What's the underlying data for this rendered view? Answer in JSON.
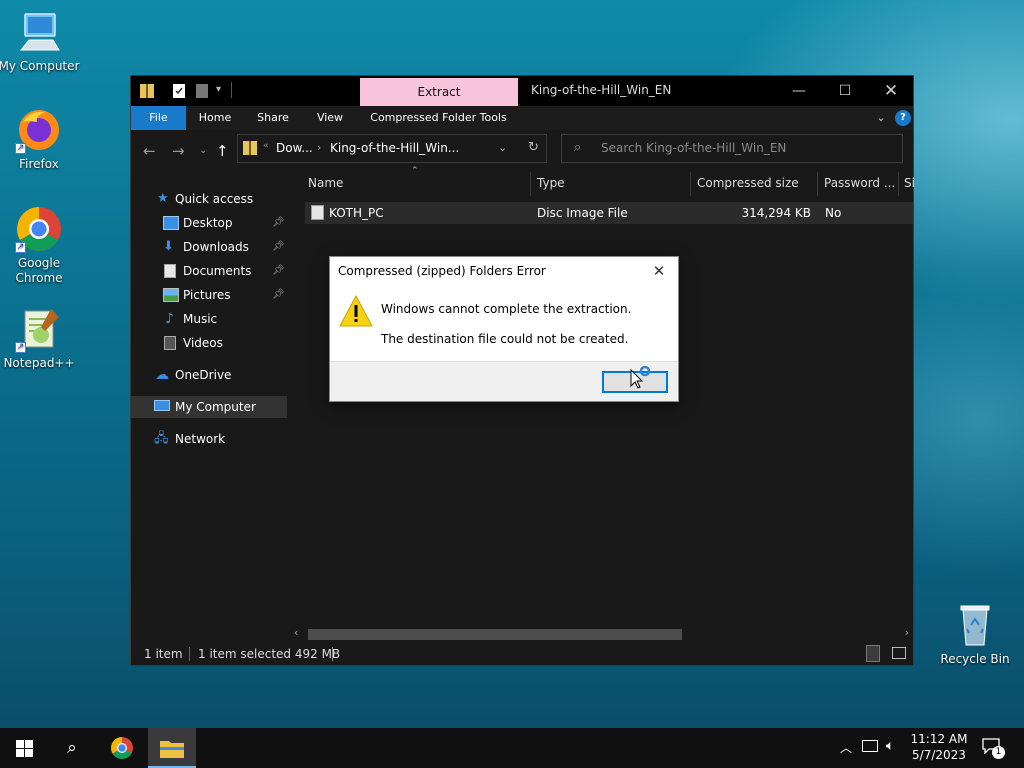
{
  "desktop": {
    "icons": [
      {
        "label": "My Computer",
        "icon": "computer-icon"
      },
      {
        "label": "Firefox",
        "icon": "firefox-icon"
      },
      {
        "label": "Google Chrome",
        "icon": "chrome-icon"
      },
      {
        "label": "Notepad++",
        "icon": "notepadpp-icon"
      },
      {
        "label": "Recycle Bin",
        "icon": "recycle-bin-icon"
      }
    ]
  },
  "explorer": {
    "title": "King-of-the-Hill_Win_EN",
    "context_tab": "Extract",
    "context_tab_color": "#f8c4dc",
    "ribbon_tabs": [
      "File",
      "Home",
      "Share",
      "View",
      "Compressed Folder Tools"
    ],
    "address": {
      "parent": "Dow...",
      "current": "King-of-the-Hill_Win..."
    },
    "search_placeholder": "Search King-of-the-Hill_Win_EN",
    "nav": {
      "quick_access": "Quick access",
      "items": [
        "Desktop",
        "Downloads",
        "Documents",
        "Pictures",
        "Music",
        "Videos"
      ],
      "onedrive": "OneDrive",
      "my_computer": "My Computer",
      "network": "Network"
    },
    "columns": [
      "Name",
      "Type",
      "Compressed size",
      "Password ...",
      "Si"
    ],
    "files": [
      {
        "name": "KOTH_PC",
        "type": "Disc Image File",
        "compressed_size": "314,294 KB",
        "password": "No"
      }
    ],
    "status": {
      "count": "1 item",
      "selected": "1 item selected  492 MB"
    }
  },
  "dialog": {
    "title": "Compressed (zipped) Folders Error",
    "message": "Windows cannot complete the extraction.",
    "detail": "The destination file could not be created.",
    "ok_label": ""
  },
  "taskbar": {
    "time": "11:12 AM",
    "date": "5/7/2023",
    "notifications": "1"
  },
  "colors": {
    "accent": "#1979ca",
    "focus": "#0078d7",
    "window_bg": "#191919"
  }
}
